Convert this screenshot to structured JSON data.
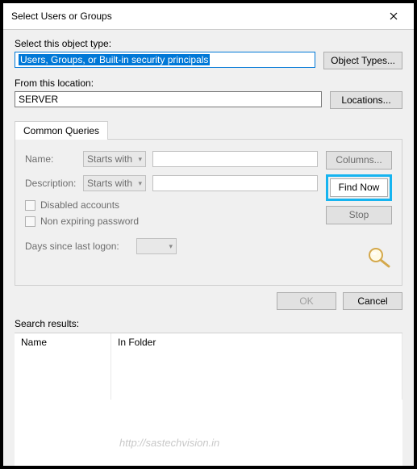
{
  "window": {
    "title": "Select Users or Groups"
  },
  "objectType": {
    "label": "Select this object type:",
    "value": "Users, Groups, or Built-in security principals",
    "button": "Object Types..."
  },
  "location": {
    "label": "From this location:",
    "value": "SERVER",
    "button": "Locations..."
  },
  "tab": {
    "label": "Common Queries"
  },
  "query": {
    "nameLabel": "Name:",
    "nameMode": "Starts with",
    "descLabel": "Description:",
    "descMode": "Starts with",
    "disabledAccounts": "Disabled accounts",
    "nonExpiring": "Non expiring password",
    "daysSince": "Days since last logon:"
  },
  "sideButtons": {
    "columns": "Columns...",
    "findNow": "Find Now",
    "stop": "Stop"
  },
  "bottom": {
    "ok": "OK",
    "cancel": "Cancel"
  },
  "results": {
    "label": "Search results:",
    "colName": "Name",
    "colFolder": "In Folder"
  },
  "watermark": "http://sastechvision.in"
}
